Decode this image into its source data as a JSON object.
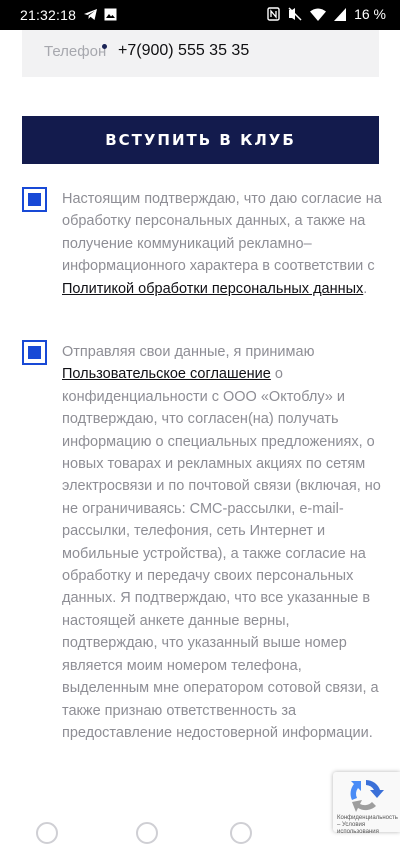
{
  "status_bar": {
    "time": "21:32:18",
    "left_icons": [
      "telegram-icon",
      "gallery-icon"
    ],
    "right_icons": [
      "nfc-icon",
      "mute-icon",
      "wifi-icon",
      "signal-icon",
      "battery-icon"
    ],
    "battery": "16 %"
  },
  "phone": {
    "label": "Телефон",
    "value": "+7(900) 555 35 35"
  },
  "join_button": "ВСТУПИТЬ В КЛУБ",
  "consent1": {
    "checked": true,
    "text_before": "Настоящим подтверждаю, что даю согласие на обработку персональных данных, а также на получение коммуникаций рекламно–информационного характера в соответствии с ",
    "link": "Политикой обработки персональных данных",
    "text_after": "."
  },
  "consent2": {
    "checked": true,
    "text_before": "Отправляя свои данные, я принимаю ",
    "link": "Пользовательское соглашение",
    "text_after": " о конфиденциальности с ООО «Октоблу» и подтверждаю, что согласен(на) получать информацию о специальных предложениях, о новых товарах и рекламных акциях по сетям электросвязи и по почтовой связи (включая, но не ограничиваясь: СМС-рассылки, e-mail-рассылки, телефония, сеть Интернет и мобильные устройства), а также согласие на обработку и передачу своих персональных данных. Я подтверждаю, что все указанные в настоящей анкете данные верны, подтверждаю, что указанный выше номер является моим номером телефона, выделенным мне оператором сотовой связи, а также признаю ответственность за предоставление недостоверной информации."
  },
  "recaptcha": {
    "text": "Конфиденциальность – Условия использования"
  }
}
